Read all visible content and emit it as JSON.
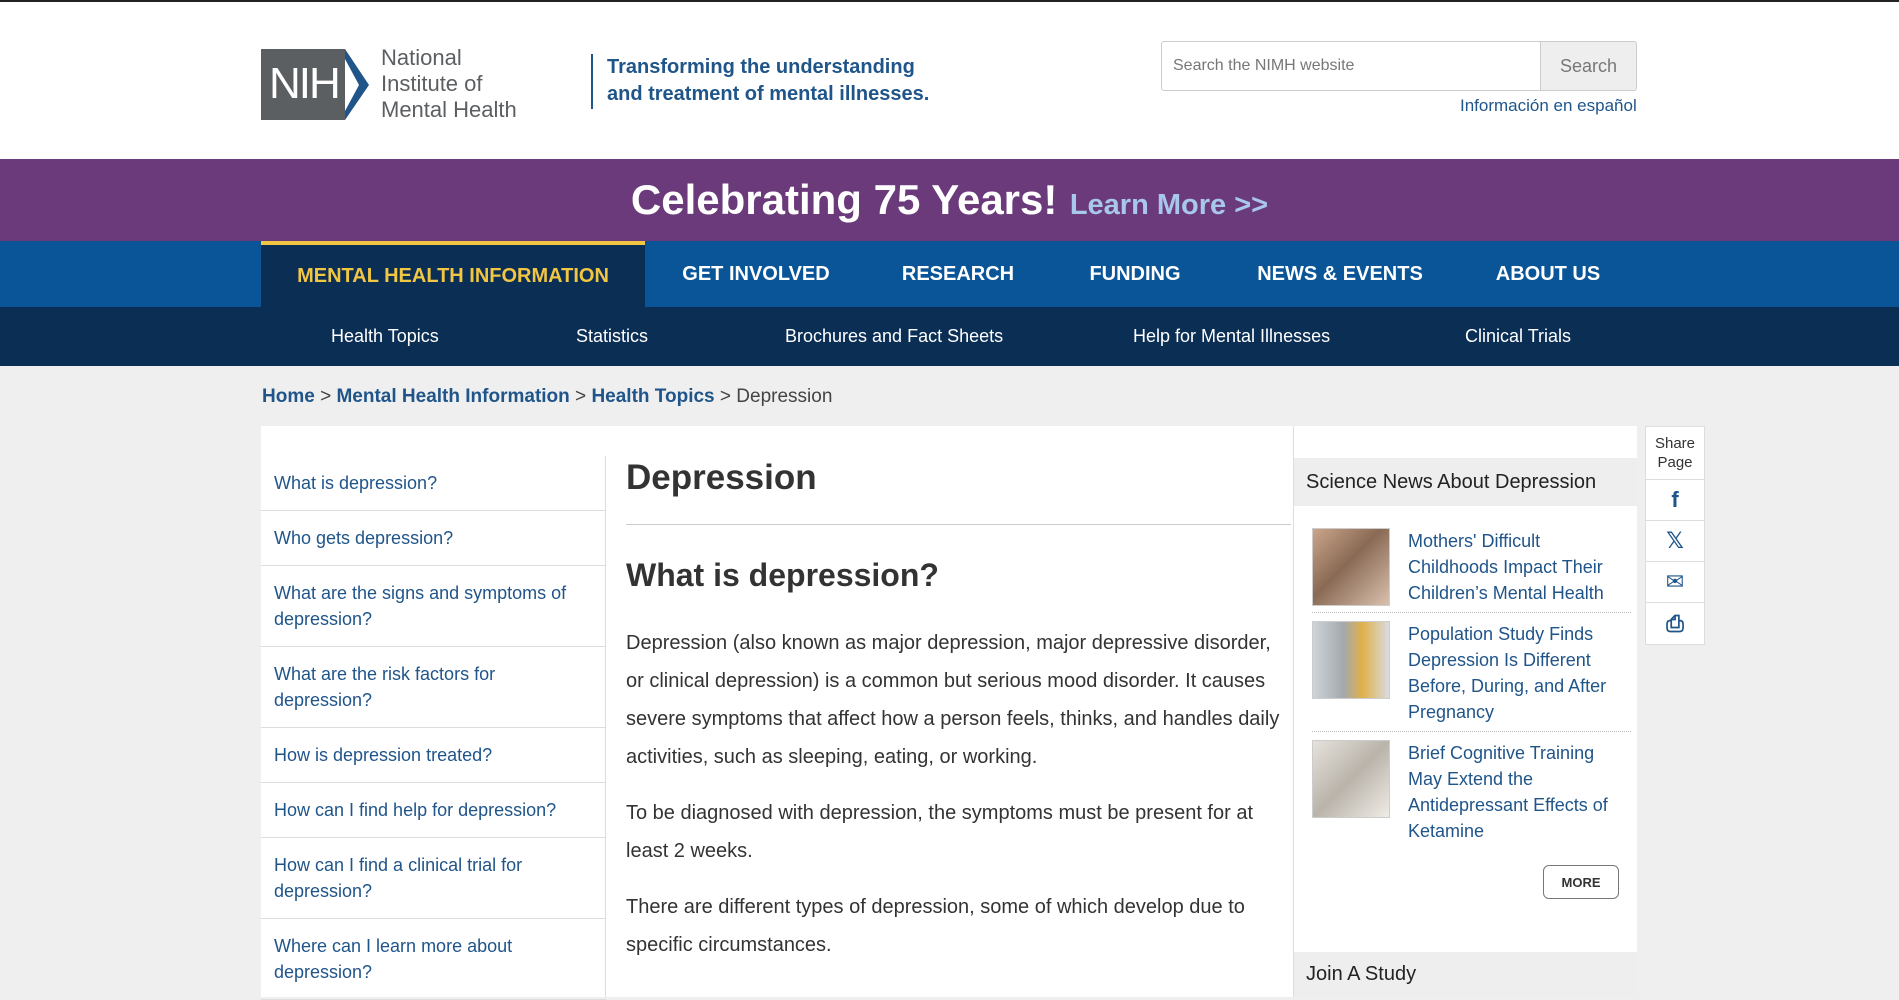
{
  "header": {
    "logo_abbr": "NIH",
    "logo_name": "National Institute of Mental Health",
    "tagline": "Transforming the understanding and treatment of mental illnesses.",
    "search_placeholder": "Search the NIMH website",
    "search_button": "Search",
    "espanol_link": "Información en español"
  },
  "banner": {
    "headline": "Celebrating 75 Years!",
    "link": "Learn More >>"
  },
  "main_nav": [
    {
      "label": "MENTAL HEALTH INFORMATION",
      "active": true
    },
    {
      "label": "GET INVOLVED"
    },
    {
      "label": "RESEARCH"
    },
    {
      "label": "FUNDING"
    },
    {
      "label": "NEWS & EVENTS"
    },
    {
      "label": "ABOUT US"
    }
  ],
  "sub_nav": [
    "Health Topics",
    "Statistics",
    "Brochures and Fact Sheets",
    "Help for Mental Illnesses",
    "Clinical Trials"
  ],
  "breadcrumb": {
    "home": "Home",
    "sep": ">",
    "level1": "Mental Health Information",
    "level2": "Health Topics",
    "current": "Depression"
  },
  "toc": [
    "What is depression?",
    "Who gets depression?",
    "What are the signs and symptoms of depression?",
    "What are the risk factors for depression?",
    "How is depression treated?",
    "How can I find help for depression?",
    "How can I find a clinical trial for depression?",
    "Where can I learn more about depression?"
  ],
  "article": {
    "title": "Depression",
    "section_heading": "What is depression?",
    "paragraphs": [
      "Depression (also known as major depression, major depressive disorder, or clinical depression) is a common but serious mood disorder. It causes severe symptoms that affect how a person feels, thinks, and handles daily activities, such as sleeping, eating, or working.",
      "To be diagnosed with depression, the symptoms must be present for at least 2 weeks.",
      "There are different types of depression, some of which develop due to specific circumstances."
    ]
  },
  "sidebar": {
    "news_heading": "Science News About Depression",
    "news": [
      {
        "title": "Mothers' Difficult Childhoods Impact Their Children’s Mental Health",
        "thumb_color": "#8a6a55"
      },
      {
        "title": "Population Study Finds Depression Is Different Before, During, and After Pregnancy",
        "thumb_color": "#a3a9ae"
      },
      {
        "title": "Brief Cognitive Training May Extend the Antidepressant Effects of Ketamine",
        "thumb_color": "#b9b3aa"
      }
    ],
    "more_button": "MORE",
    "study_heading": "Join A Study"
  },
  "share": {
    "label": "Share Page",
    "buttons": [
      {
        "name": "facebook-icon",
        "glyph": "f"
      },
      {
        "name": "x-icon",
        "glyph": "𝕏"
      },
      {
        "name": "email-icon",
        "glyph": "✉"
      },
      {
        "name": "print-icon",
        "glyph": "⎙"
      }
    ]
  }
}
